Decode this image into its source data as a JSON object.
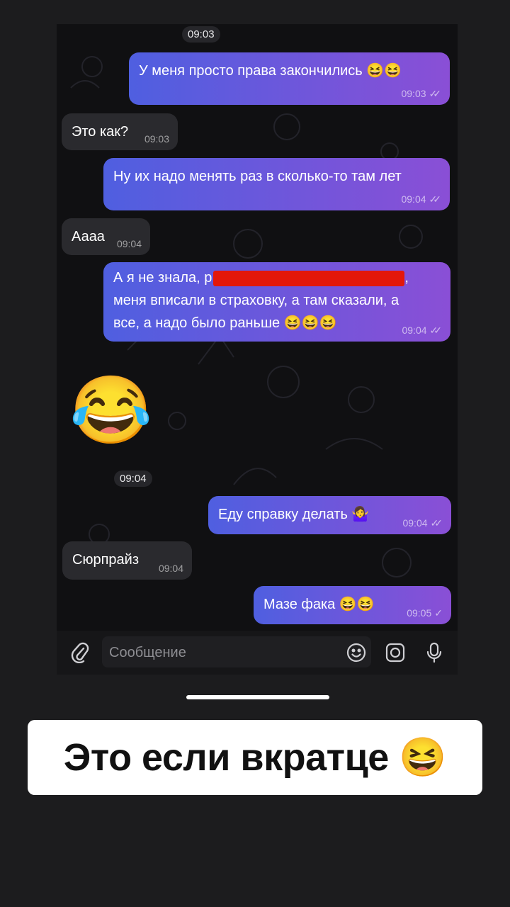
{
  "chat": {
    "date_pill": "09:03",
    "messages": [
      {
        "dir": "out",
        "text": "У меня просто права закончились 😆😆",
        "time": "09:03",
        "ticks": "✓✓"
      },
      {
        "dir": "in",
        "text": "Это как?",
        "time": "09:03"
      },
      {
        "dir": "out",
        "text": "Ну их надо менять раз в сколько-то там лет",
        "time": "09:04",
        "ticks": "✓✓"
      },
      {
        "dir": "in",
        "text": "Аааа",
        "time": "09:04"
      },
      {
        "dir": "out",
        "line1_start": "А я не знала, р",
        "line1_end": ",",
        "line2": "меня вписали в страховку, а там сказали, а",
        "line3": "все, а надо было раньше 😆😆😆",
        "time": "09:04",
        "ticks": "✓✓"
      },
      {
        "dir": "in",
        "sticker": "😂",
        "time": "09:04"
      },
      {
        "dir": "out",
        "text": "Еду справку делать 🤷‍♀️",
        "time": "09:04",
        "ticks": "✓✓"
      },
      {
        "dir": "in",
        "text": "Сюрпрайз",
        "time": "09:04"
      },
      {
        "dir": "out",
        "text": "Мазе фака 😆😆",
        "time": "09:05",
        "ticks": "✓"
      }
    ]
  },
  "input": {
    "placeholder": "Сообщение",
    "icons": [
      "attach-icon",
      "emoji-icon",
      "camera-icon",
      "mic-icon"
    ]
  },
  "caption": "Это если вкратце 😆",
  "colors": {
    "bubble_out_start": "#4f5fe0",
    "bubble_out_end": "#8a4fd6",
    "bubble_in": "#2a2a2e",
    "redaction": "#e3170a"
  }
}
